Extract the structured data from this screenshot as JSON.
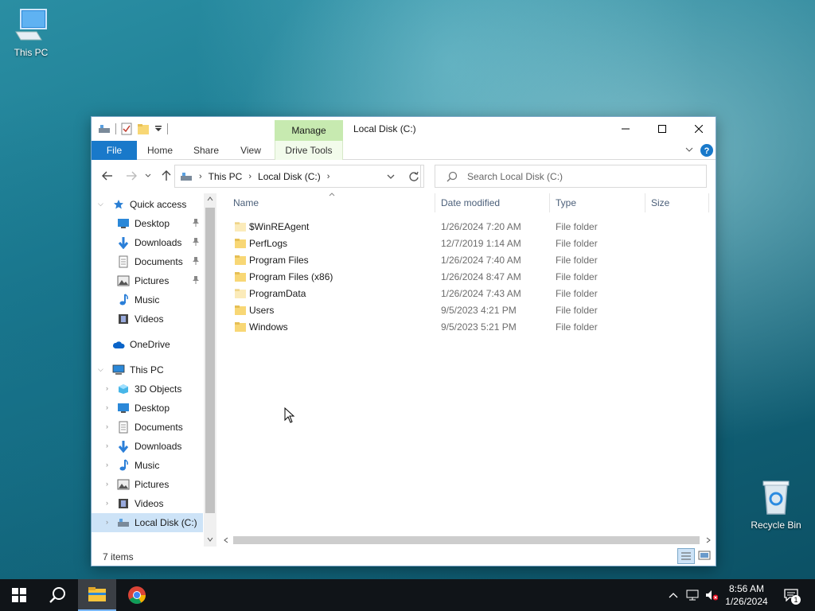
{
  "desktop": {
    "icons": [
      {
        "label": "This PC",
        "icon": "this-pc-icon"
      },
      {
        "label": "Recycle Bin",
        "icon": "recycle-bin-icon"
      }
    ]
  },
  "window": {
    "title": "Local Disk (C:)",
    "context_tab_group": "Manage",
    "ribbon_tabs": [
      "File",
      "Home",
      "Share",
      "View",
      "Drive Tools"
    ],
    "address": {
      "crumbs": [
        "This PC",
        "Local Disk (C:)"
      ]
    },
    "search": {
      "placeholder": "Search Local Disk (C:)"
    },
    "nav_pane": {
      "quick_access": {
        "label": "Quick access",
        "items": [
          {
            "label": "Desktop",
            "pinned": true
          },
          {
            "label": "Downloads",
            "pinned": true
          },
          {
            "label": "Documents",
            "pinned": true
          },
          {
            "label": "Pictures",
            "pinned": true
          },
          {
            "label": "Music",
            "pinned": false
          },
          {
            "label": "Videos",
            "pinned": false
          }
        ]
      },
      "onedrive": {
        "label": "OneDrive"
      },
      "this_pc": {
        "label": "This PC",
        "items": [
          "3D Objects",
          "Desktop",
          "Documents",
          "Downloads",
          "Music",
          "Pictures",
          "Videos",
          "Local Disk (C:)"
        ],
        "selected": "Local Disk (C:)"
      }
    },
    "columns": [
      "Name",
      "Date modified",
      "Type",
      "Size"
    ],
    "files": [
      {
        "name": "$WinREAgent",
        "date": "1/26/2024 7:20 AM",
        "type": "File folder",
        "faded": true
      },
      {
        "name": "PerfLogs",
        "date": "12/7/2019 1:14 AM",
        "type": "File folder",
        "faded": false
      },
      {
        "name": "Program Files",
        "date": "1/26/2024 7:40 AM",
        "type": "File folder",
        "faded": false
      },
      {
        "name": "Program Files (x86)",
        "date": "1/26/2024 8:47 AM",
        "type": "File folder",
        "faded": false
      },
      {
        "name": "ProgramData",
        "date": "1/26/2024 7:43 AM",
        "type": "File folder",
        "faded": true
      },
      {
        "name": "Users",
        "date": "9/5/2023 4:21 PM",
        "type": "File folder",
        "faded": false
      },
      {
        "name": "Windows",
        "date": "9/5/2023 5:21 PM",
        "type": "File folder",
        "faded": false
      }
    ],
    "status": {
      "count": "7 items"
    }
  },
  "taskbar": {
    "time": "8:56 AM",
    "date": "1/26/2024",
    "notification_count": "1"
  },
  "colors": {
    "file_tab": "#1979ca",
    "manage_tab": "#c7eab0",
    "selection": "#cde3f7",
    "folder": "#f8d775"
  }
}
